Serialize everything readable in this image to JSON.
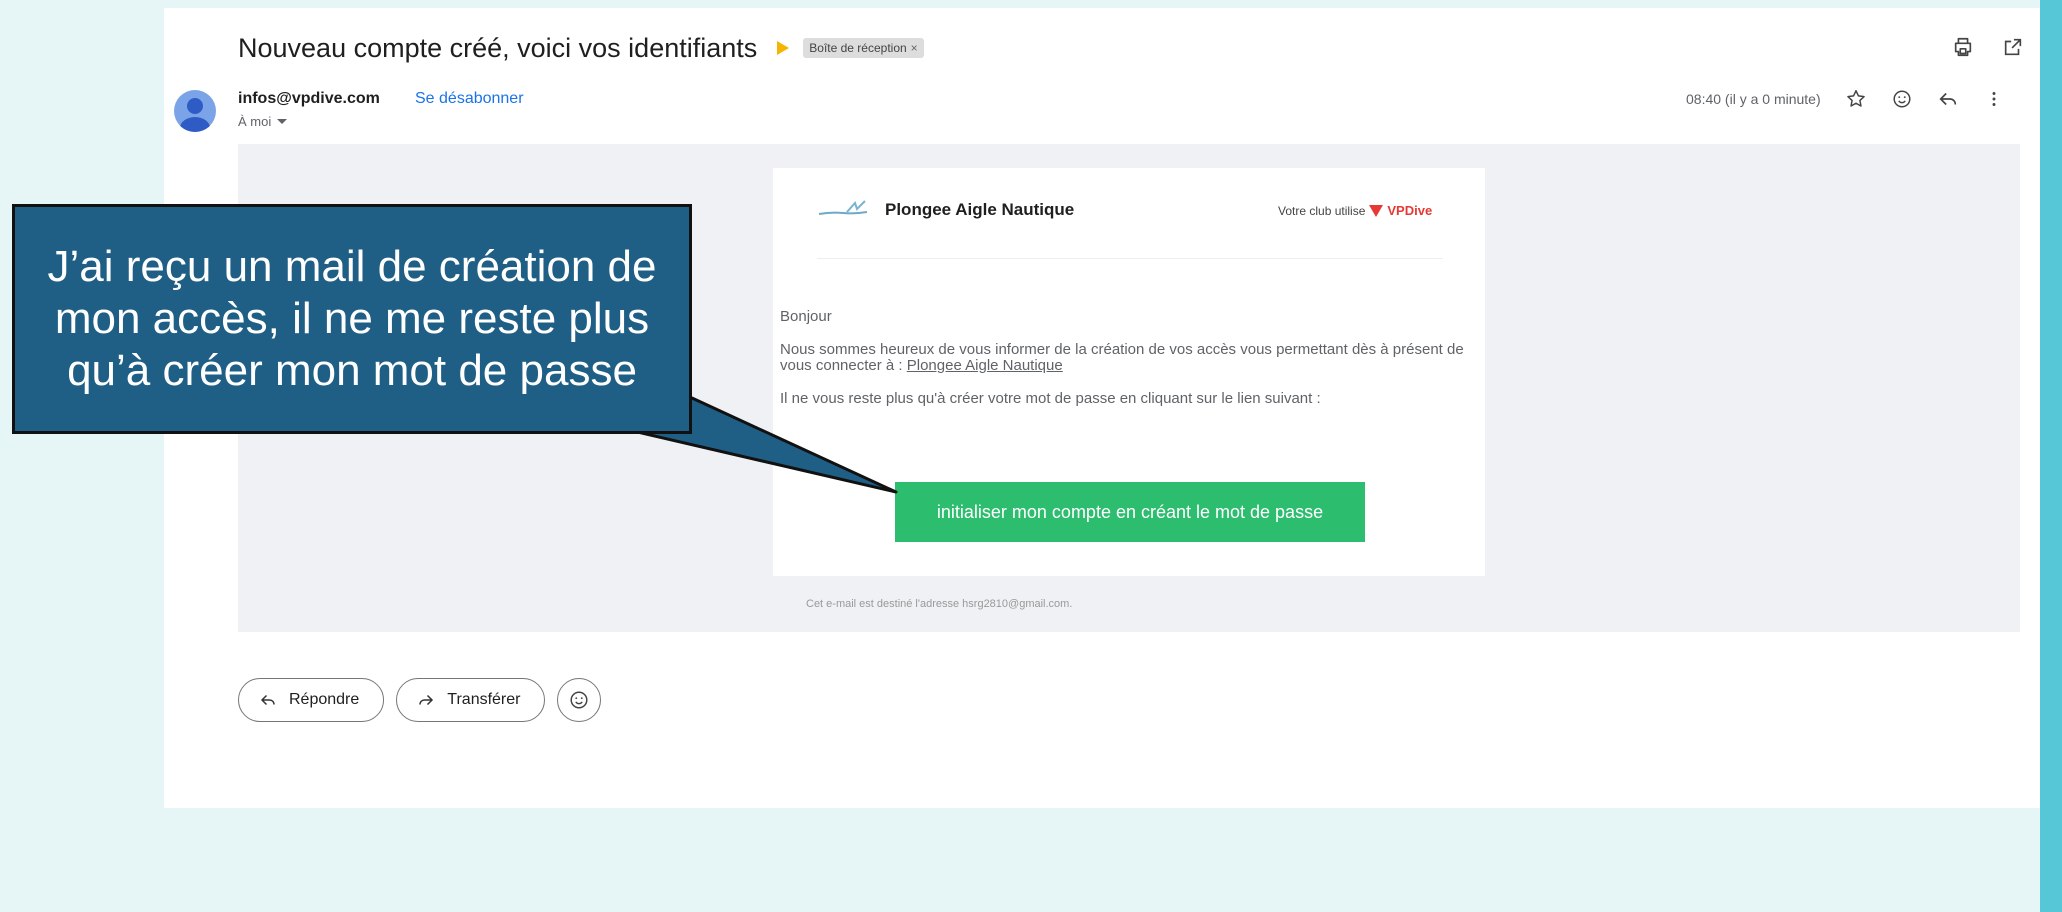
{
  "email": {
    "subject": "Nouveau compte créé, voici vos identifiants",
    "label": "Boîte de réception",
    "label_close": "×",
    "sender": "infos@vpdive.com",
    "unsubscribe": "Se désabonner",
    "to": "À moi",
    "timestamp": "08:40 (il y a 0 minute)"
  },
  "icons": {
    "print": "print-icon",
    "open_new": "open-in-new-window-icon",
    "star": "star-icon",
    "emoji": "emoji-icon",
    "reply": "reply-icon",
    "more": "more-vert-icon"
  },
  "card": {
    "club_name": "Plongee Aigle Nautique",
    "uses_label": "Votre club utilise",
    "brand": "VPDive",
    "greeting": "Bonjour",
    "para1_text": "Nous sommes heureux de vous informer de la création de vos accès vous permettant dès à présent de vous connecter à :",
    "para1_link": "Plongee Aigle Nautique",
    "para2": "Il ne vous reste plus qu'à créer votre mot de passe en cliquant sur le lien suivant :",
    "cta": "initialiser mon compte en créant le mot de passe",
    "footer": "Cet e-mail est destiné l'adresse hsrg2810@gmail.com."
  },
  "actions": {
    "reply": "Répondre",
    "forward": "Transférer"
  },
  "callout": {
    "text": "J’ai reçu un mail de création de mon accès, il ne me reste plus qu’à créer mon mot de passe"
  },
  "colors": {
    "background": "#e6f6f6",
    "accent_strip": "#56c7d6",
    "cta_green": "#2dbd6e",
    "callout_blue": "#1f5f86",
    "link_blue": "#1a73e8",
    "brand_red": "#e53935"
  }
}
